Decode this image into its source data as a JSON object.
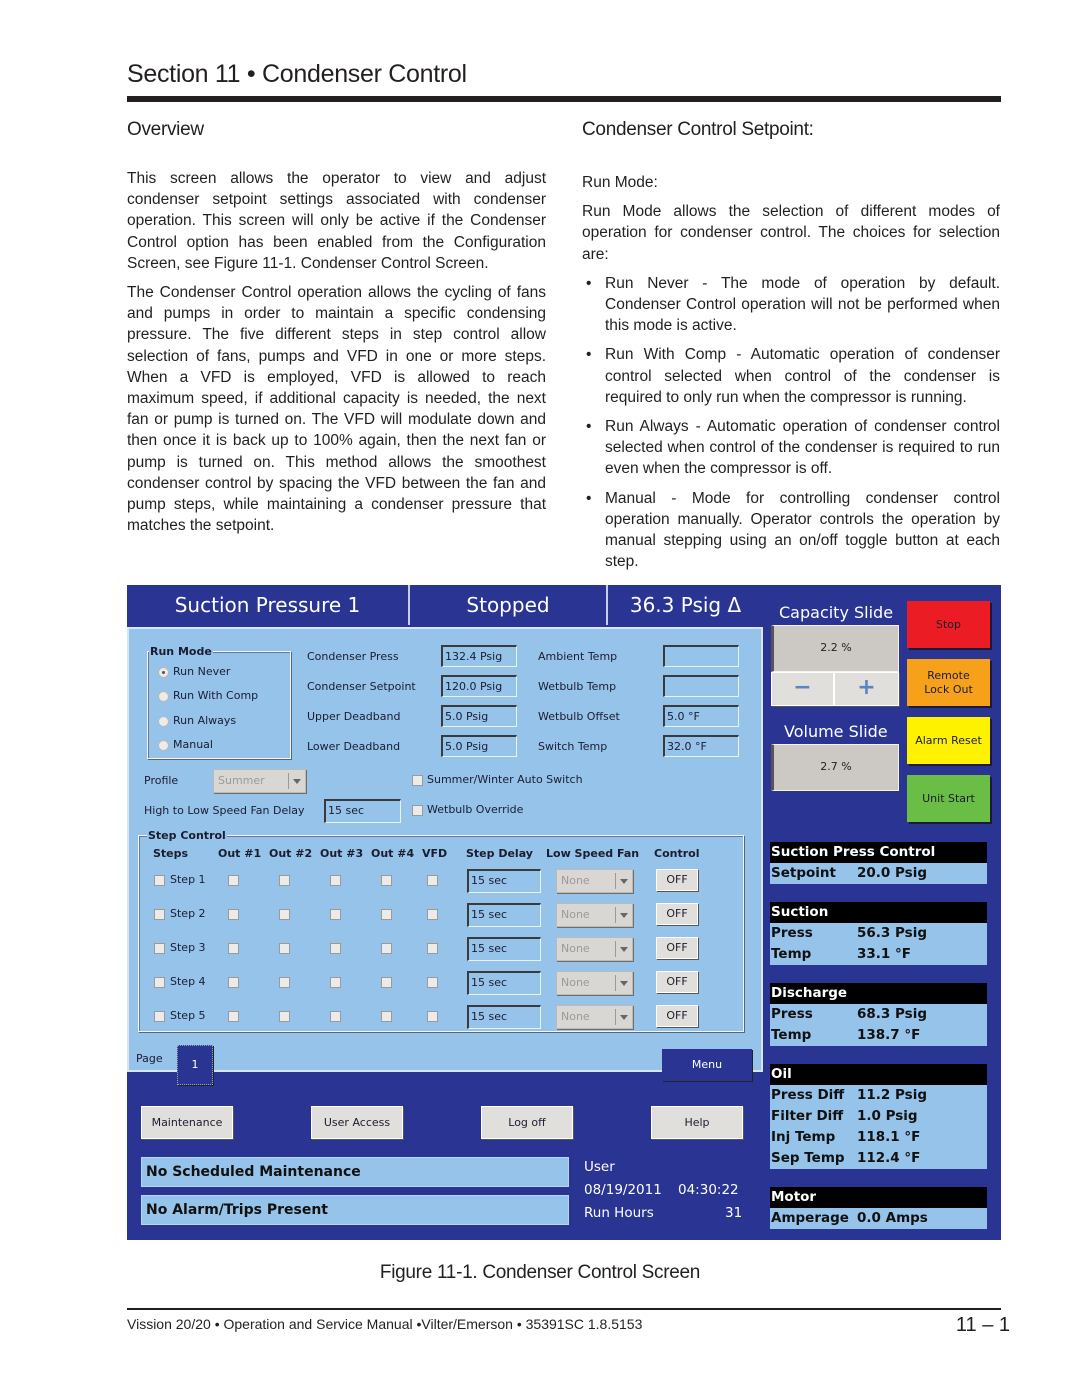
{
  "doc": {
    "title": "Section 11 • Condenser Control",
    "overview_heading": "Overview",
    "overview_paragraphs": [
      "This screen allows the operator to view and adjust condenser setpoint settings associated with condenser operation. This screen will only be active if the Condenser Control option has been enabled from the Configuration Screen, see Figure 11-1. Condenser Control Screen.",
      "The Condenser Control operation allows the cycling of fans and pumps in order to maintain a specific condensing pressure. The five different steps in step control allow selection of fans, pumps and VFD in one or more steps. When a VFD is employed, VFD is allowed to reach maximum speed, if additional capacity is needed, the next fan or pump is turned on. The VFD will modulate down and then once it is back up to 100% again, then the next fan or pump is turned on. This method allows the smoothest condenser control by spacing the VFD between the fan and pump steps, while maintaining a condenser pressure that matches the setpoint."
    ],
    "setpoint_heading": "Condenser Control Setpoint:",
    "run_mode_label": "Run Mode:",
    "run_mode_intro": "Run Mode allows the selection of different modes of operation for condenser control. The choices for selection are:",
    "bullets": [
      "Run Never - The mode of operation by default. Condenser Control operation will not be performed when this mode is active.",
      "Run With Comp - Automatic operation of condenser control selected when control of the condenser is required to only run when the compressor is running.",
      "Run Always - Automatic operation of condenser control selected when control of the condenser is required to run even when the compressor is off.",
      "Manual - Mode for controlling condenser control operation manually. Operator controls the operation by manual stepping using an on/off toggle button at each step."
    ],
    "bullet_glyph": "•",
    "figure_caption": "Figure 11-1. Condenser Control Screen",
    "footer": "Vission 20/20 • Operation and Service Manual •Vilter/Emerson • 35391SC 1.8.5153",
    "page_number": "11 – 1"
  },
  "hmi": {
    "header": {
      "compressor": "Suction Pressure 1",
      "status": "Stopped",
      "reading": "36.3 Psig Δ"
    },
    "run_mode": {
      "title": "Run Mode",
      "options": [
        "Run Never",
        "Run With Comp",
        "Run Always",
        "Manual"
      ],
      "selected": "Run Never"
    },
    "left_fields": [
      {
        "label": "Condenser Press",
        "value": "132.4 Psig"
      },
      {
        "label": "Condenser Setpoint",
        "value": "120.0 Psig"
      },
      {
        "label": "Upper Deadband",
        "value": "5.0 Psig"
      },
      {
        "label": "Lower Deadband",
        "value": "5.0 Psig"
      }
    ],
    "right_fields": [
      {
        "label": "Ambient Temp",
        "value": ""
      },
      {
        "label": "Wetbulb Temp",
        "value": ""
      },
      {
        "label": "Wetbulb Offset",
        "value": "5.0 °F"
      },
      {
        "label": "Switch Temp",
        "value": "32.0 °F"
      }
    ],
    "profile": {
      "label": "Profile",
      "value": "Summer"
    },
    "fan_delay": {
      "label": "High to Low Speed Fan Delay",
      "value": "15 sec"
    },
    "summer_winter_auto_switch": {
      "label": "Summer/Winter Auto Switch",
      "checked": false
    },
    "wetbulb_override": {
      "label": "Wetbulb Override",
      "checked": false
    },
    "step_control": {
      "title": "Step Control",
      "columns": [
        "Steps",
        "Out #1",
        "Out #2",
        "Out #3",
        "Out #4",
        "VFD",
        "Step Delay",
        "Low Speed Fan",
        "Control"
      ],
      "rows": [
        {
          "step": "Step 1",
          "delay": "15 sec",
          "low_speed_fan": "None",
          "control": "OFF"
        },
        {
          "step": "Step 2",
          "delay": "15 sec",
          "low_speed_fan": "None",
          "control": "OFF"
        },
        {
          "step": "Step 3",
          "delay": "15 sec",
          "low_speed_fan": "None",
          "control": "OFF"
        },
        {
          "step": "Step 4",
          "delay": "15 sec",
          "low_speed_fan": "None",
          "control": "OFF"
        },
        {
          "step": "Step 5",
          "delay": "15 sec",
          "low_speed_fan": "None",
          "control": "OFF"
        }
      ]
    },
    "page": {
      "label": "Page",
      "value": "1"
    },
    "menu_label": "Menu",
    "bottom_buttons": [
      "Maintenance",
      "User Access",
      "Log off",
      "Help"
    ],
    "messages": [
      "No Scheduled Maintenance",
      "No Alarm/Trips Present"
    ],
    "info": {
      "user": "User",
      "date": "08/19/2011",
      "time": "04:30:22",
      "run_hours_label": "Run Hours",
      "run_hours": "31"
    },
    "capacity_slide": {
      "title": "Capacity Slide",
      "value": "2.2 %",
      "minus": "−",
      "plus": "+"
    },
    "volume_slide": {
      "title": "Volume Slide",
      "value": "2.7 %"
    },
    "control_buttons": [
      {
        "label": "Stop",
        "color": "#ec1c24"
      },
      {
        "label": "Remote Lock Out",
        "color": "#f7a11a"
      },
      {
        "label": "Alarm Reset",
        "color": "#fff200"
      },
      {
        "label": "Unit Start",
        "color": "#6abd45"
      }
    ],
    "status_groups": [
      {
        "title": "Suction Press Control",
        "rows": [
          {
            "k": "Setpoint",
            "v": "20.0 Psig"
          }
        ]
      },
      {
        "title": "Suction",
        "rows": [
          {
            "k": "Press",
            "v": "56.3 Psig"
          },
          {
            "k": "Temp",
            "v": "33.1 °F"
          }
        ]
      },
      {
        "title": "Discharge",
        "rows": [
          {
            "k": "Press",
            "v": "68.3 Psig"
          },
          {
            "k": "Temp",
            "v": "138.7 °F"
          }
        ]
      },
      {
        "title": "Oil",
        "rows": [
          {
            "k": "Press Diff",
            "v": "11.2 Psig"
          },
          {
            "k": "Filter Diff",
            "v": "1.0 Psig"
          },
          {
            "k": "Inj Temp",
            "v": "118.1 °F"
          },
          {
            "k": "Sep Temp",
            "v": "112.4 °F"
          }
        ]
      },
      {
        "title": "Motor",
        "rows": [
          {
            "k": "Amperage",
            "v": "0.0 Amps"
          }
        ]
      }
    ]
  }
}
